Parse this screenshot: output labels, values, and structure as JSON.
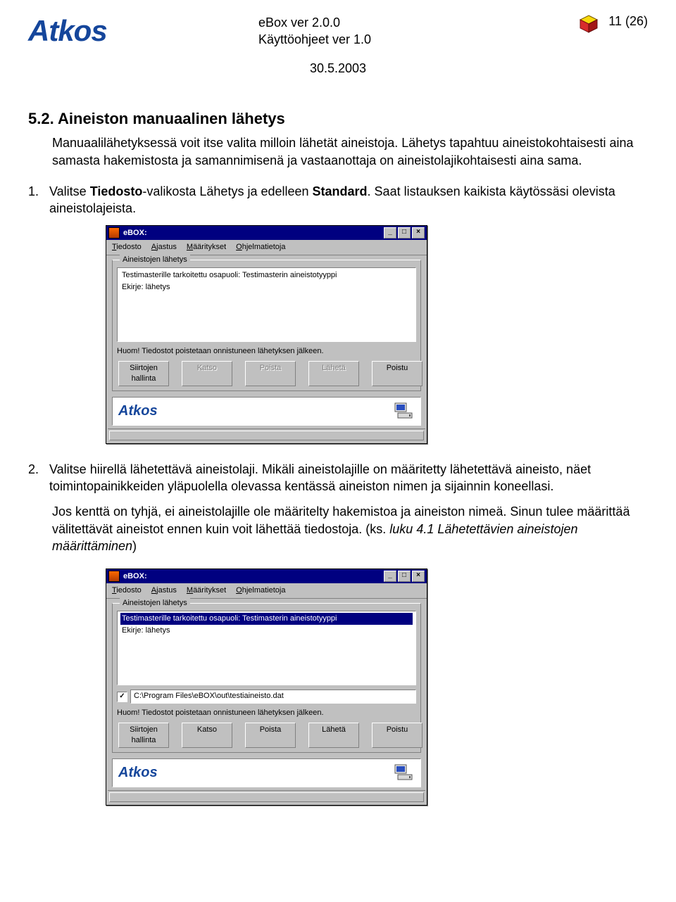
{
  "header": {
    "logo_text": "Atkos",
    "doc_title_line1": "eBox ver 2.0.0",
    "doc_title_line2": "Käyttöohjeet ver 1.0",
    "page_number": "11 (26)",
    "date": "30.5.2003"
  },
  "section": {
    "number": "5.2.",
    "title": "Aineiston manuaalinen lähetys",
    "intro": "Manuaalilähetyksessä voit itse valita milloin lähetät aineistoja. Lähetys tapahtuu aineistokohtaisesti aina samasta hakemistosta ja samannimisenä ja vastaanottaja on aineistolajikohtaisesti aina sama.",
    "steps": [
      {
        "num": "1.",
        "pre": "Valitse ",
        "bold1": "Tiedosto",
        "mid1": "-valikosta Lähetys ja edelleen ",
        "bold2": "Standard",
        "post": ". Saat listauksen kaikista käytössäsi olevista aineistolajeista."
      },
      {
        "num": "2.",
        "text": "Valitse hiirellä lähetettävä aineistolaji. Mikäli aineistolajille on määritetty lähetettävä aineisto, näet toimintopainikkeiden yläpuolella olevassa kentässä aineiston nimen ja sijainnin koneellasi."
      }
    ],
    "para2_a": "Jos kenttä on tyhjä, ei aineistolajille ole määritelty hakemistoa ja aineiston nimeä. Sinun tulee määrittää välitettävät aineistot ennen kuin voit lähettää tiedostoja. (ks. ",
    "para2_ital": "luku 4.1 Lähetettävien aineistojen määrittäminen",
    "para2_b": ")"
  },
  "window": {
    "title": "eBOX:",
    "menus": [
      "Tiedosto",
      "Ajastus",
      "Määritykset",
      "Ohjelmatietoja"
    ],
    "group_label": "Aineistojen lähetys",
    "list_items": [
      "Testimasterille tarkoitettu osapuoli: Testimasterin aineistotyyppi",
      "Ekirje: lähetys"
    ],
    "note_text": "Huom! Tiedostot poistetaan onnistuneen lähetyksen jälkeen.",
    "buttons": {
      "siirtojen": "Siirtojen hallinta",
      "katso": "Katso",
      "poista": "Poista",
      "laheta": "Lähetä",
      "poistu": "Poistu"
    },
    "brand": "Atkos",
    "win_controls": {
      "min": "_",
      "max": "□",
      "close": "×"
    },
    "path_checked": "✓",
    "path_value": "C:\\Program Files\\eBOX\\out\\testiaineisto.dat"
  }
}
